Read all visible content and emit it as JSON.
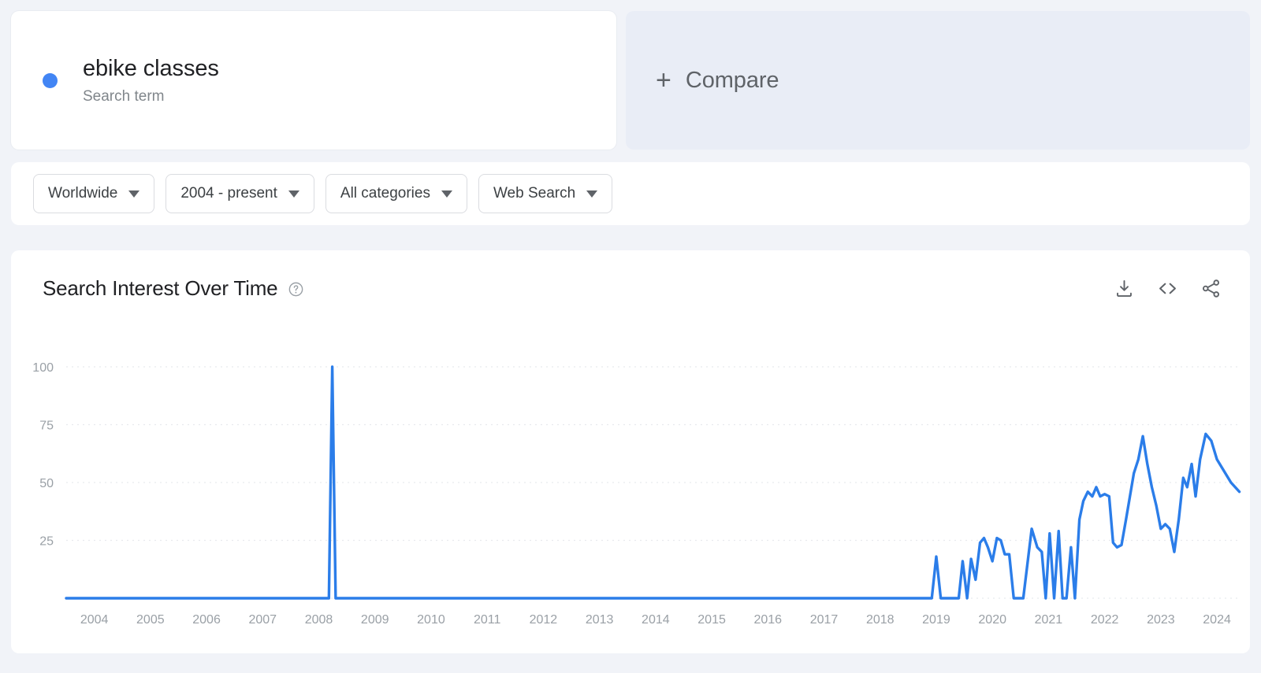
{
  "term_card": {
    "title": "ebike classes",
    "subtitle": "Search term",
    "dot_color": "#4285f4"
  },
  "compare_card": {
    "plus": "+",
    "label": "Compare"
  },
  "filters": [
    {
      "label": "Worldwide"
    },
    {
      "label": "2004 - present"
    },
    {
      "label": "All categories"
    },
    {
      "label": "Web Search"
    }
  ],
  "chart_panel": {
    "title": "Search Interest Over Time",
    "help_icon": "help-circle-icon",
    "actions": [
      {
        "name": "download-icon"
      },
      {
        "name": "embed-code-icon"
      },
      {
        "name": "share-icon"
      }
    ]
  },
  "chart_data": {
    "type": "line",
    "title": "Search Interest Over Time",
    "xlabel": "",
    "ylabel": "",
    "series_name": "ebike classes",
    "color": "#2b7de9",
    "grid": true,
    "legend": "none",
    "ylim": [
      0,
      100
    ],
    "yticks": [
      100,
      75,
      50,
      25
    ],
    "xlim": [
      2004,
      2024.92
    ],
    "xticks": [
      2004,
      2005,
      2006,
      2007,
      2008,
      2009,
      2010,
      2011,
      2012,
      2013,
      2014,
      2015,
      2016,
      2017,
      2018,
      2019,
      2020,
      2021,
      2022,
      2023,
      2024
    ],
    "note": "Monthly Google Trends relative search interest, 0-100 scale. Flat at 0 from 2004 to mid-2019 apart from one isolated spike to 100 in late 2008.",
    "points": [
      [
        2004.0,
        0
      ],
      [
        2004.5,
        0
      ],
      [
        2005.0,
        0
      ],
      [
        2005.5,
        0
      ],
      [
        2006.0,
        0
      ],
      [
        2006.5,
        0
      ],
      [
        2007.0,
        0
      ],
      [
        2007.5,
        0
      ],
      [
        2008.0,
        0
      ],
      [
        2008.3,
        0
      ],
      [
        2008.6,
        0
      ],
      [
        2008.68,
        0
      ],
      [
        2008.74,
        100
      ],
      [
        2008.8,
        0
      ],
      [
        2008.9,
        0
      ],
      [
        2009.0,
        0
      ],
      [
        2009.5,
        0
      ],
      [
        2010.0,
        0
      ],
      [
        2010.5,
        0
      ],
      [
        2011.0,
        0
      ],
      [
        2011.5,
        0
      ],
      [
        2012.0,
        0
      ],
      [
        2012.5,
        0
      ],
      [
        2013.0,
        0
      ],
      [
        2013.5,
        0
      ],
      [
        2014.0,
        0
      ],
      [
        2014.5,
        0
      ],
      [
        2015.0,
        0
      ],
      [
        2015.5,
        0
      ],
      [
        2016.0,
        0
      ],
      [
        2016.5,
        0
      ],
      [
        2017.0,
        0
      ],
      [
        2017.5,
        0
      ],
      [
        2018.0,
        0
      ],
      [
        2018.5,
        0
      ],
      [
        2019.0,
        0
      ],
      [
        2019.2,
        0
      ],
      [
        2019.35,
        0
      ],
      [
        2019.42,
        0
      ],
      [
        2019.5,
        18
      ],
      [
        2019.58,
        0
      ],
      [
        2019.7,
        0
      ],
      [
        2019.8,
        0
      ],
      [
        2019.9,
        0
      ],
      [
        2019.97,
        16
      ],
      [
        2020.05,
        0
      ],
      [
        2020.12,
        17
      ],
      [
        2020.2,
        8
      ],
      [
        2020.28,
        24
      ],
      [
        2020.35,
        26
      ],
      [
        2020.42,
        22
      ],
      [
        2020.5,
        16
      ],
      [
        2020.58,
        26
      ],
      [
        2020.65,
        25
      ],
      [
        2020.72,
        19
      ],
      [
        2020.8,
        19
      ],
      [
        2020.88,
        0
      ],
      [
        2020.95,
        0
      ],
      [
        2021.05,
        0
      ],
      [
        2021.12,
        14
      ],
      [
        2021.2,
        30
      ],
      [
        2021.3,
        22
      ],
      [
        2021.38,
        20
      ],
      [
        2021.45,
        0
      ],
      [
        2021.52,
        28
      ],
      [
        2021.6,
        0
      ],
      [
        2021.68,
        29
      ],
      [
        2021.75,
        0
      ],
      [
        2021.82,
        0
      ],
      [
        2021.9,
        22
      ],
      [
        2021.97,
        0
      ],
      [
        2022.05,
        34
      ],
      [
        2022.12,
        42
      ],
      [
        2022.2,
        46
      ],
      [
        2022.28,
        44
      ],
      [
        2022.35,
        48
      ],
      [
        2022.42,
        44
      ],
      [
        2022.5,
        45
      ],
      [
        2022.58,
        44
      ],
      [
        2022.65,
        24
      ],
      [
        2022.72,
        22
      ],
      [
        2022.8,
        23
      ],
      [
        2022.88,
        34
      ],
      [
        2022.95,
        44
      ],
      [
        2023.02,
        54
      ],
      [
        2023.1,
        60
      ],
      [
        2023.18,
        70
      ],
      [
        2023.26,
        58
      ],
      [
        2023.34,
        48
      ],
      [
        2023.42,
        40
      ],
      [
        2023.5,
        30
      ],
      [
        2023.58,
        32
      ],
      [
        2023.66,
        30
      ],
      [
        2023.74,
        20
      ],
      [
        2023.82,
        34
      ],
      [
        2023.9,
        52
      ],
      [
        2023.97,
        48
      ],
      [
        2024.05,
        58
      ],
      [
        2024.12,
        44
      ],
      [
        2024.2,
        60
      ],
      [
        2024.3,
        71
      ],
      [
        2024.4,
        68
      ],
      [
        2024.5,
        60
      ],
      [
        2024.6,
        56
      ],
      [
        2024.75,
        50
      ],
      [
        2024.9,
        46
      ]
    ]
  }
}
